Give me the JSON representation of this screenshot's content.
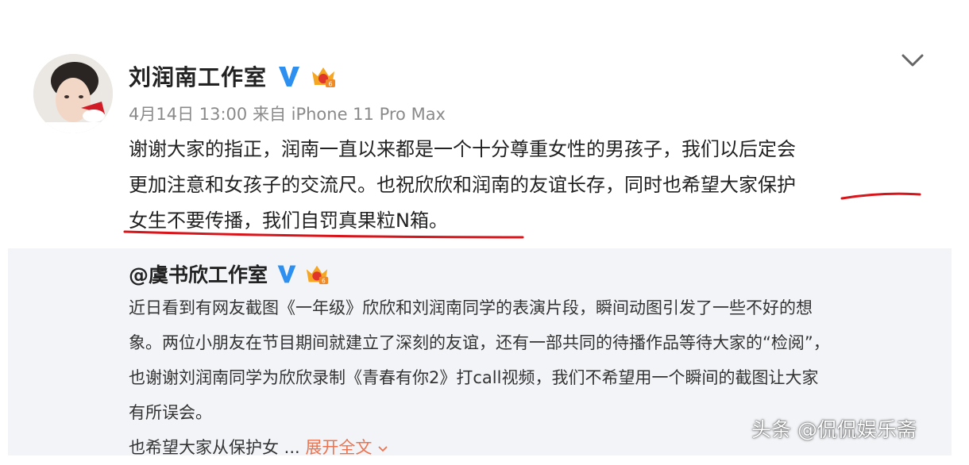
{
  "post": {
    "author": "刘润南工作室",
    "meta": "4月14日 13:00 来自 iPhone 11 Pro Max",
    "text_line1": "谢谢大家的指正，润南一直以来都是一个十分尊重女性的男孩子，我们以后定会",
    "text_line2_a": "更加注意和女孩子的交流尺。也祝欣欣和润南的友谊长存，同时也希望大家保护",
    "text_line3": "女生不要传播，我们自罚真果粒N箱。"
  },
  "quote": {
    "author": "@虞书欣工作室",
    "line1": "近日看到有网友截图《一年级》欣欣和刘润南同学的表演片段，瞬间动图引发了一些不好的想",
    "line2": "象。两位小朋友在节目期间就建立了深刻的友谊，还有一部共同的待播作品等待大家的“检阅”，",
    "line3": "也谢谢刘润南同学为欣欣录制《青春有你2》打call视频，我们不希望用一个瞬间的截图让大家",
    "line4": "有所误会。",
    "line5": "也希望大家从保护女 ...",
    "expand": "展开全文"
  },
  "watermark": "头条 @侃侃娱乐斋",
  "colors": {
    "verified": "#2d8ff0",
    "crown": "#f5a623",
    "link": "#eb7350",
    "underline": "#d8151b",
    "quote_bg": "#f2f4f7"
  },
  "icons": [
    "avatar",
    "verified-v-icon",
    "member-crown-icon",
    "chevron-down-icon"
  ]
}
